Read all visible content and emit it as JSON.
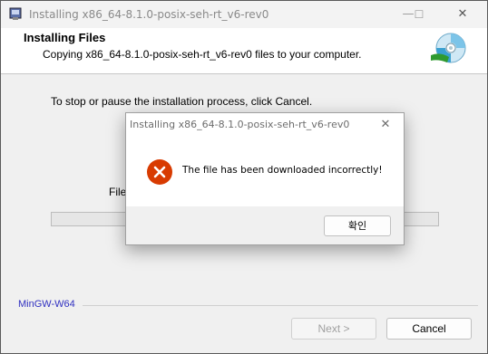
{
  "window": {
    "title": "Installing x86_64-8.1.0-posix-seh-rt_v6-rev0",
    "minimize_glyph": "—",
    "maximize_glyph": "☐",
    "close_glyph": "✕"
  },
  "header": {
    "title": "Installing Files",
    "subtitle": "Copying x86_64-8.1.0-posix-seh-rt_v6-rev0 files to your computer.",
    "icon": "cd-disc-icon"
  },
  "body": {
    "instruction": "To stop or pause the installation process, click Cancel.",
    "file_label": "File",
    "progress": 0
  },
  "footer": {
    "brand": "MinGW-W64",
    "next_label": "Next >",
    "cancel_label": "Cancel"
  },
  "dialog": {
    "title": "Installing x86_64-8.1.0-posix-seh-rt_v6-rev0",
    "close_glyph": "✕",
    "icon": "error-icon",
    "message": "The file has been downloaded incorrectly!",
    "ok_label": "확인"
  },
  "colors": {
    "error_red": "#d83b01",
    "brand_blue": "#3030c0"
  }
}
